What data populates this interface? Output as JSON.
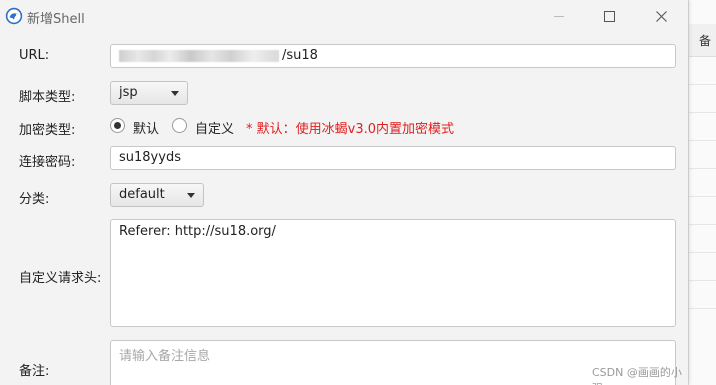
{
  "window": {
    "title": "新增Shell"
  },
  "form": {
    "url_label": "URL:",
    "url_value": "/su18",
    "script_type_label": "脚本类型:",
    "script_type_value": "jsp",
    "encryption_label": "加密类型:",
    "encryption_options": [
      {
        "label": "默认",
        "selected": true
      },
      {
        "label": "自定义",
        "selected": false
      }
    ],
    "encryption_hint": "* 默认：使用冰蝎v3.0内置加密模式",
    "password_label": "连接密码:",
    "password_value": "su18yyds",
    "category_label": "分类:",
    "category_value": "default",
    "headers_label": "自定义请求头:",
    "headers_value": "Referer: http://su18.org/",
    "notes_label": "备注:",
    "notes_placeholder": "请输入备注信息"
  },
  "background": {
    "column_header": "备"
  },
  "watermark": "CSDN @画画的小强",
  "colors": {
    "hint": "#e02020",
    "background": "#f3f3f3"
  }
}
